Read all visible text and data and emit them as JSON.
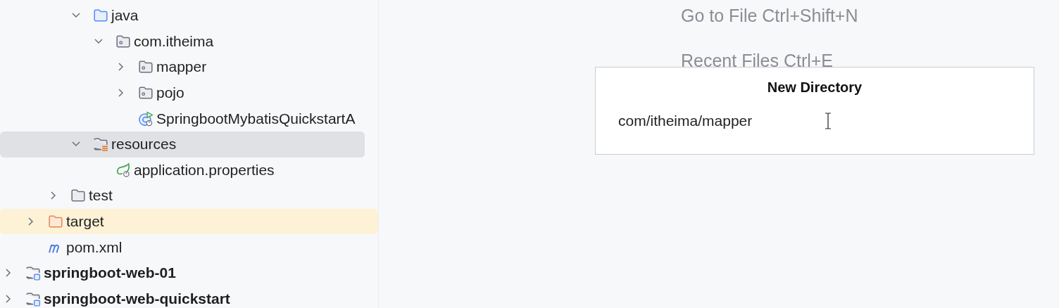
{
  "project_tree": {
    "items": [
      {
        "children": [
          {
            "children": [
              {
                "children": [
                  {
                    "label": "java",
                    "kind": "source-folder",
                    "expanded": true,
                    "selected": false,
                    "excluded": false,
                    "children": [
                      {
                        "label": "com.itheima",
                        "kind": "package",
                        "expanded": true,
                        "selected": false,
                        "excluded": false,
                        "children": [
                          {
                            "label": "mapper",
                            "kind": "package",
                            "expanded": false,
                            "selected": false,
                            "excluded": false
                          },
                          {
                            "label": "pojo",
                            "kind": "package",
                            "expanded": false,
                            "selected": false,
                            "excluded": false
                          },
                          {
                            "label": "SpringbootMybatisQuickstartA",
                            "kind": "spring-class",
                            "selected": false,
                            "excluded": false
                          }
                        ]
                      }
                    ]
                  },
                  {
                    "label": "resources",
                    "kind": "resources-folder",
                    "expanded": true,
                    "selected": true,
                    "excluded": false,
                    "children": [
                      {
                        "label": "application.properties",
                        "kind": "spring-properties",
                        "selected": false,
                        "excluded": false
                      }
                    ]
                  }
                ]
              },
              {
                "label": "test",
                "kind": "folder",
                "expanded": false,
                "selected": false,
                "excluded": false
              }
            ]
          },
          {
            "label": "target",
            "kind": "folder",
            "expanded": false,
            "selected": false,
            "excluded": true
          },
          {
            "label": "pom.xml",
            "kind": "maven",
            "selected": false,
            "excluded": false
          }
        ]
      },
      {
        "label": "springboot-web-01",
        "kind": "module",
        "expanded": false,
        "selected": false,
        "excluded": false
      },
      {
        "label": "springboot-web-quickstart",
        "kind": "module",
        "expanded": false,
        "selected": false,
        "excluded": false
      }
    ]
  },
  "editor_hints": [
    "Go to File Ctrl+Shift+N",
    "Recent Files Ctrl+E"
  ],
  "new_directory_popup": {
    "title": "New Directory",
    "value": "com/itheima/mapper"
  }
}
